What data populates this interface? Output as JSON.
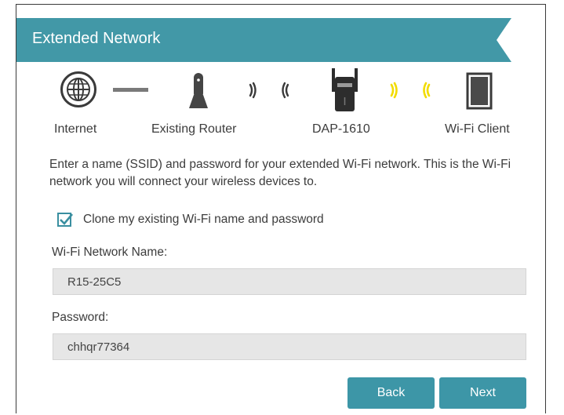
{
  "header": {
    "title": "Extended Network",
    "color": "#4298a7"
  },
  "diagram": {
    "devices": [
      {
        "label": "Internet",
        "icon": "globe-icon"
      },
      {
        "label": "Existing Router",
        "icon": "router-icon"
      },
      {
        "label": "DAP-1610",
        "icon": "extender-icon"
      },
      {
        "label": "Wi-Fi Client",
        "icon": "tablet-icon"
      }
    ],
    "wifi_wave_color": "#f2dc00"
  },
  "description": "Enter a name (SSID) and password for your extended Wi-Fi network. This is the Wi-Fi network you will connect your wireless devices to.",
  "clone": {
    "label": "Clone my existing Wi-Fi name and password",
    "checked": true
  },
  "network_name": {
    "label": "Wi-Fi Network Name:",
    "value": "R15-25C5"
  },
  "password": {
    "label": "Password:",
    "value": "chhqr77364"
  },
  "buttons": {
    "back": "Back",
    "next": "Next"
  },
  "accent_color": "#3d96a7"
}
